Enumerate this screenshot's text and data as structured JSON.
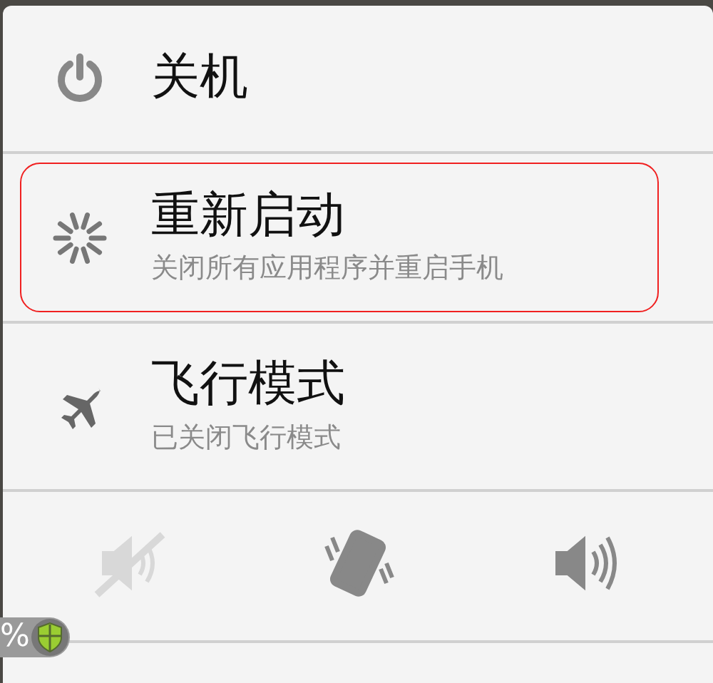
{
  "options": [
    {
      "kind": "power",
      "title": "关机",
      "highlighted": false
    },
    {
      "kind": "restart",
      "title": "重新启动",
      "subtitle": "关闭所有应用程序并重启手机",
      "highlighted": true
    },
    {
      "kind": "airplane",
      "title": "飞行模式",
      "subtitle": "已关闭飞行模式",
      "highlighted": false
    }
  ],
  "sound_modes": [
    {
      "kind": "silent",
      "disabled": true
    },
    {
      "kind": "vibrate",
      "disabled": false
    },
    {
      "kind": "sound",
      "disabled": false
    }
  ],
  "status_fragment": {
    "text": "%"
  }
}
